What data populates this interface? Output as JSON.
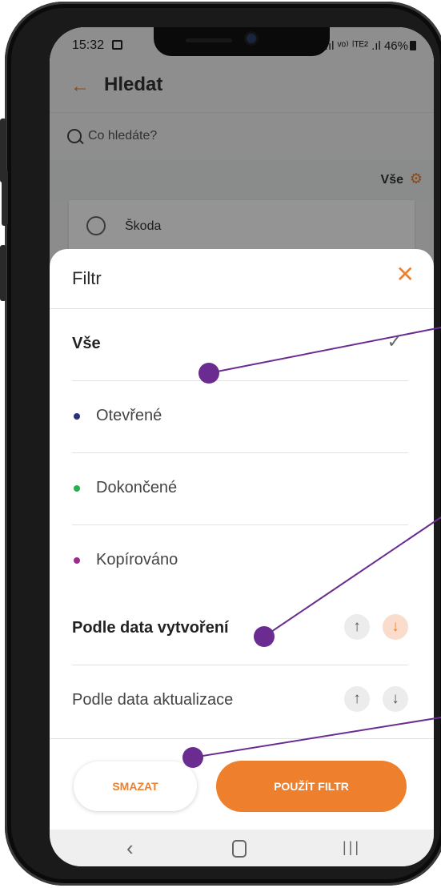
{
  "status_bar": {
    "time": "15:32",
    "signal": ".ıl ᵛᵒ⁾ ˡᵀᴱ² .ıl",
    "battery": "46%"
  },
  "app_bar": {
    "title": "Hledat"
  },
  "search": {
    "placeholder": "Co hledáte?"
  },
  "filter_summary": {
    "label": "Vše"
  },
  "background_card": {
    "label": "Škoda"
  },
  "filter_sheet": {
    "title": "Filtr",
    "options": [
      {
        "label": "Vše",
        "selected": true
      },
      {
        "label": "Otevřené",
        "dot_color": "#2b2f7a"
      },
      {
        "label": "Dokončené",
        "dot_color": "#22b24c"
      },
      {
        "label": "Kopírováno",
        "dot_color": "#9b2d8f"
      }
    ],
    "sort": [
      {
        "label": "Podle data vytvoření",
        "up": "↑",
        "down": "↓",
        "active": "down"
      },
      {
        "label": "Podle data aktualizace",
        "up": "↑",
        "down": "↓",
        "active": "none"
      }
    ],
    "clear_label": "SMAZAT",
    "apply_label": "POUŽÍT FILTR"
  },
  "colors": {
    "accent": "#ee7f2d",
    "annotation": "#6a2c91"
  },
  "icons": {
    "back": "arrow-left-icon",
    "search": "search-icon",
    "tune": "tune-icon",
    "close": "close-icon",
    "check": "check-icon",
    "card": "history-icon"
  }
}
